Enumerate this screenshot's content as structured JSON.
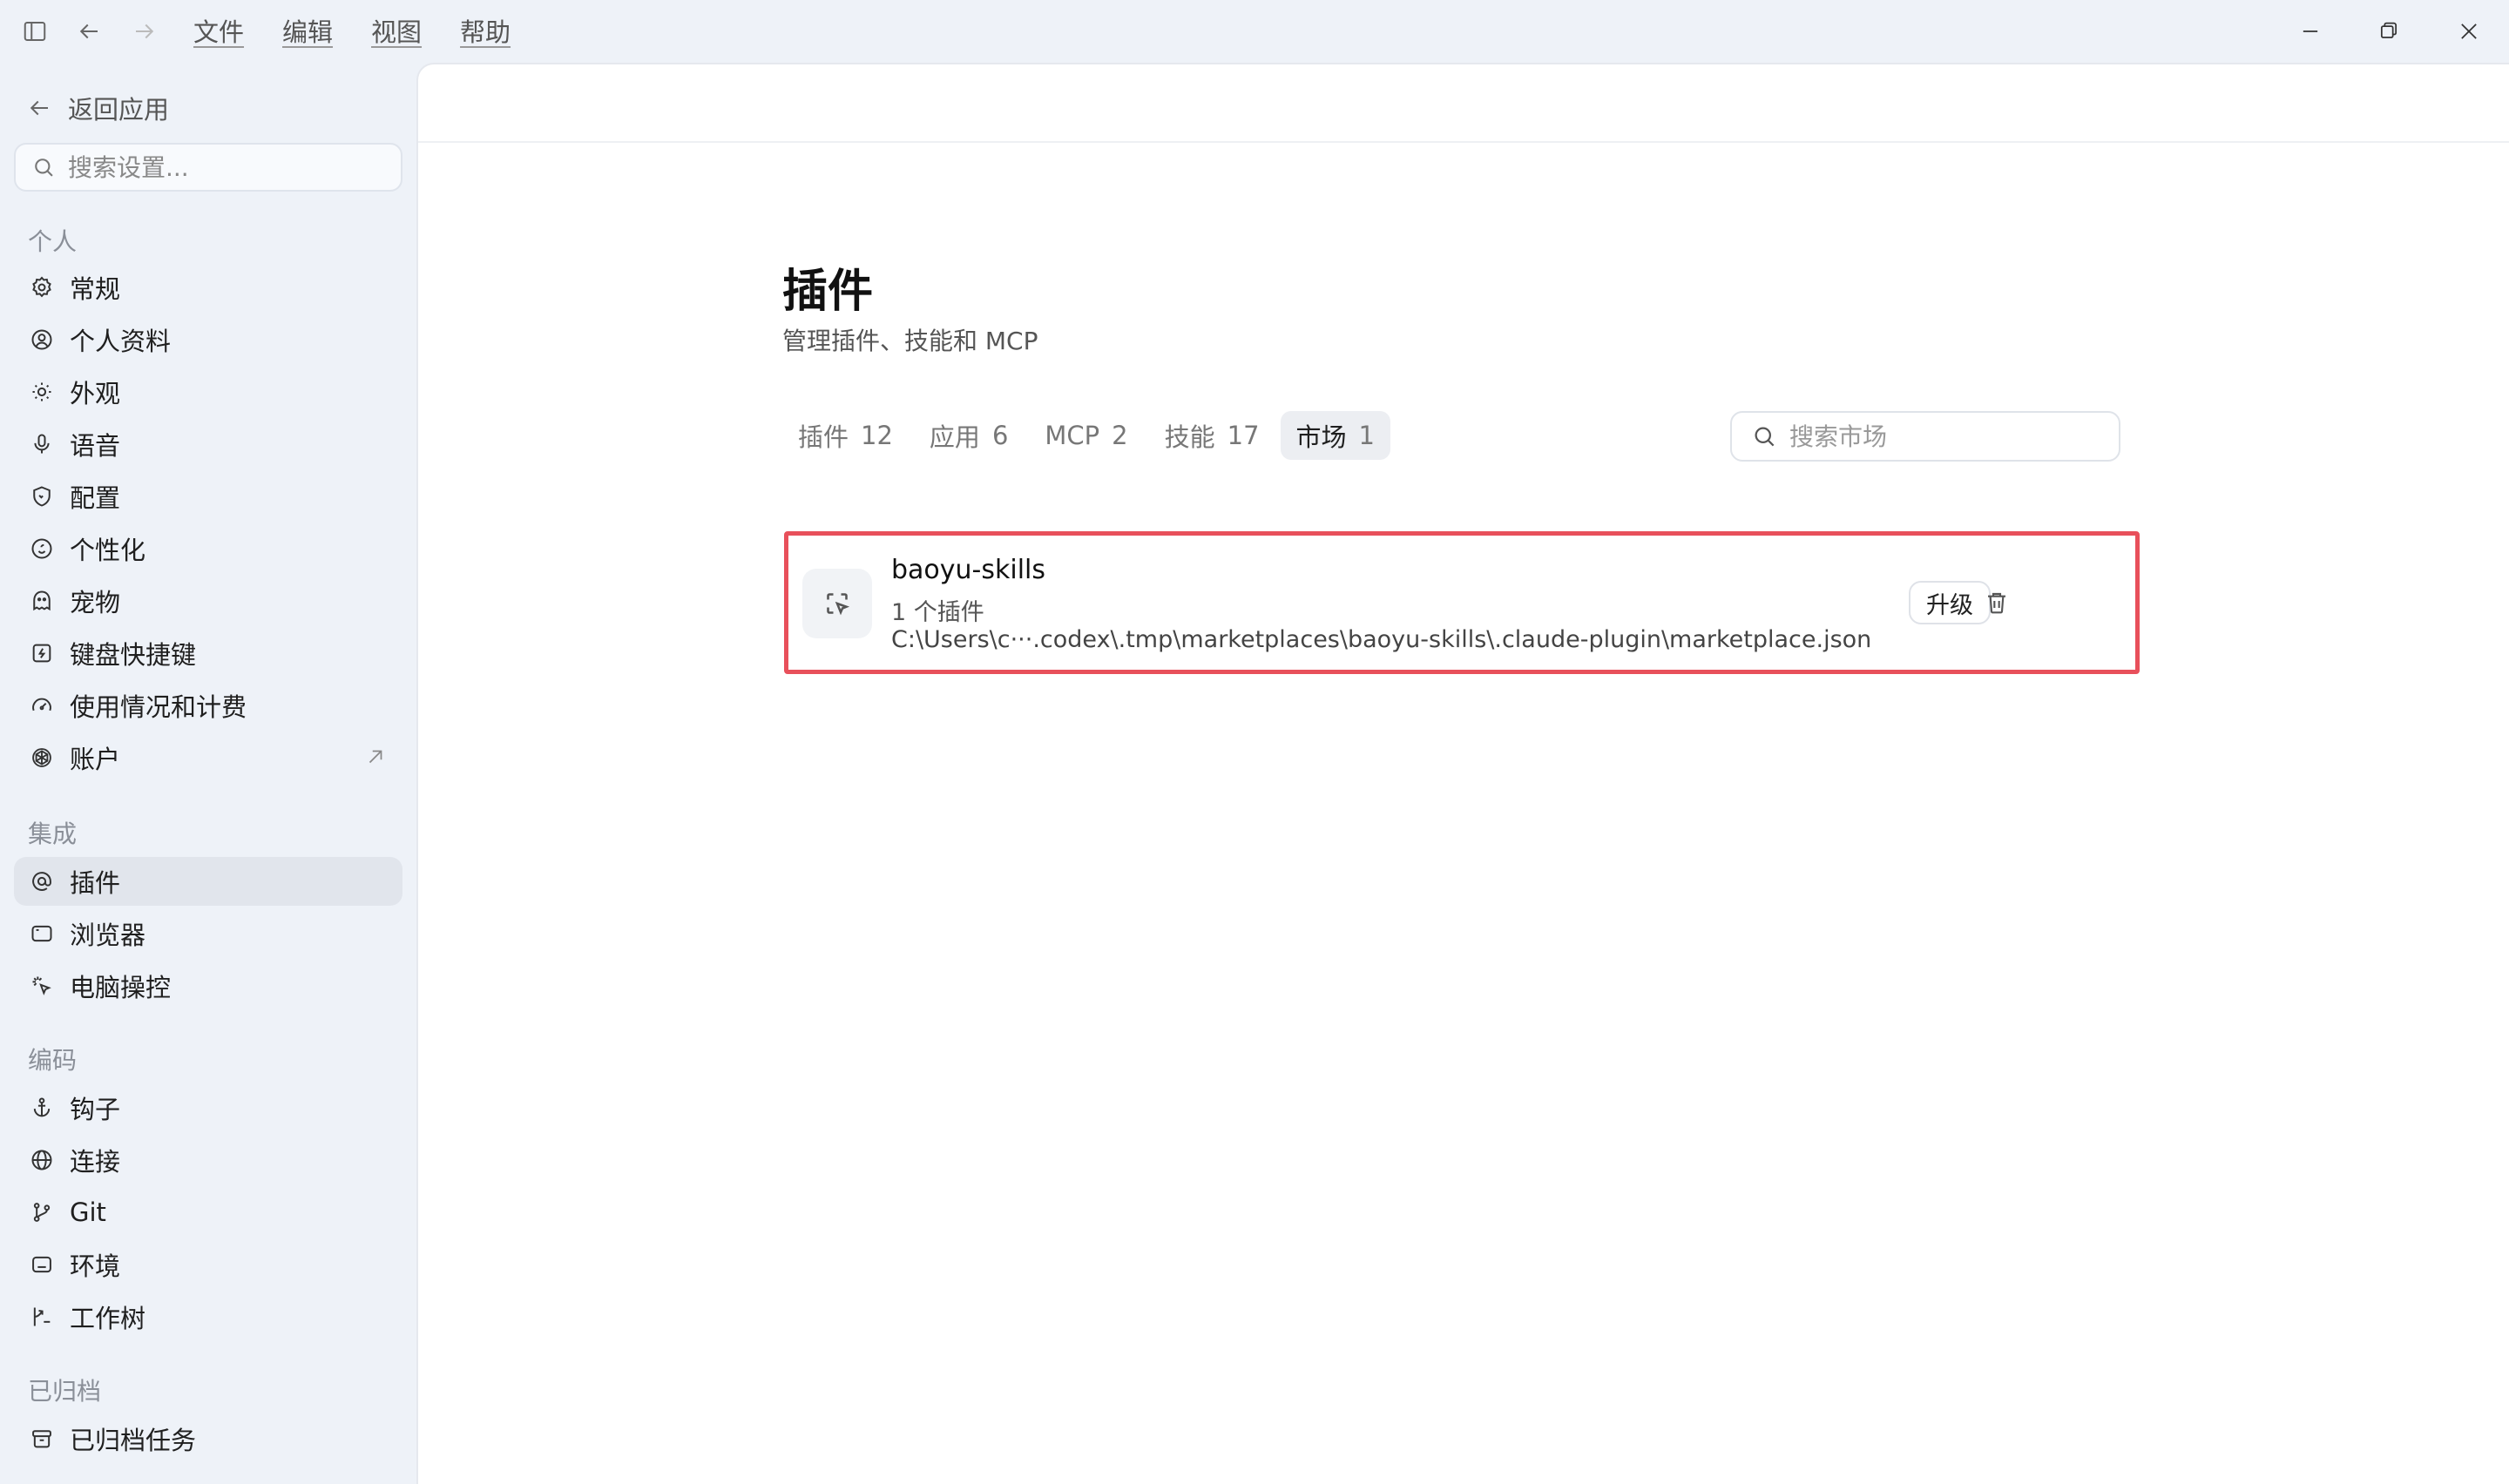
{
  "menu": [
    "文件",
    "编辑",
    "视图",
    "帮助"
  ],
  "sidebar": {
    "back_label": "返回应用",
    "search_placeholder": "搜索设置...",
    "sections": [
      {
        "title": "个人",
        "items": [
          {
            "label": "常规",
            "icon": "gear-icon"
          },
          {
            "label": "个人资料",
            "icon": "user-circle-icon"
          },
          {
            "label": "外观",
            "icon": "sun-icon"
          },
          {
            "label": "语音",
            "icon": "microphone-icon"
          },
          {
            "label": "配置",
            "icon": "shield-icon"
          },
          {
            "label": "个性化",
            "icon": "smile-icon"
          },
          {
            "label": "宠物",
            "icon": "pet-icon"
          },
          {
            "label": "键盘快捷键",
            "icon": "keyboard-icon"
          },
          {
            "label": "使用情况和计费",
            "icon": "gauge-icon"
          },
          {
            "label": "账户",
            "icon": "openai-icon",
            "external": true
          }
        ]
      },
      {
        "title": "集成",
        "items": [
          {
            "label": "插件",
            "icon": "at-icon",
            "active": true
          },
          {
            "label": "浏览器",
            "icon": "browser-icon"
          },
          {
            "label": "电脑操控",
            "icon": "cursor-icon"
          }
        ]
      },
      {
        "title": "编码",
        "items": [
          {
            "label": "钩子",
            "icon": "anchor-icon"
          },
          {
            "label": "连接",
            "icon": "globe-icon"
          },
          {
            "label": "Git",
            "icon": "git-branch-icon"
          },
          {
            "label": "环境",
            "icon": "terminal-icon"
          },
          {
            "label": "工作树",
            "icon": "worktree-icon"
          }
        ]
      },
      {
        "title": "已归档",
        "items": [
          {
            "label": "已归档任务",
            "icon": "archive-icon"
          }
        ]
      }
    ]
  },
  "page": {
    "title": "插件",
    "subtitle": "管理插件、技能和 MCP",
    "tabs": [
      {
        "label": "插件",
        "count": "12"
      },
      {
        "label": "应用",
        "count": "6"
      },
      {
        "label": "MCP",
        "count": "2"
      },
      {
        "label": "技能",
        "count": "17"
      },
      {
        "label": "市场",
        "count": "1",
        "active": true
      }
    ],
    "search_placeholder": "搜索市场",
    "marketplace": {
      "name": "baoyu-skills",
      "plugin_count": "1 个插件",
      "path": "C:\\Users\\c···.codex\\.tmp\\marketplaces\\baoyu-skills\\.claude-plugin\\marketplace.json",
      "upgrade_label": "升级"
    }
  },
  "colors": {
    "highlight_border": "#e8505b",
    "sidebar_bg": "#eef2f8",
    "active_item_bg": "#e1e5ec"
  }
}
